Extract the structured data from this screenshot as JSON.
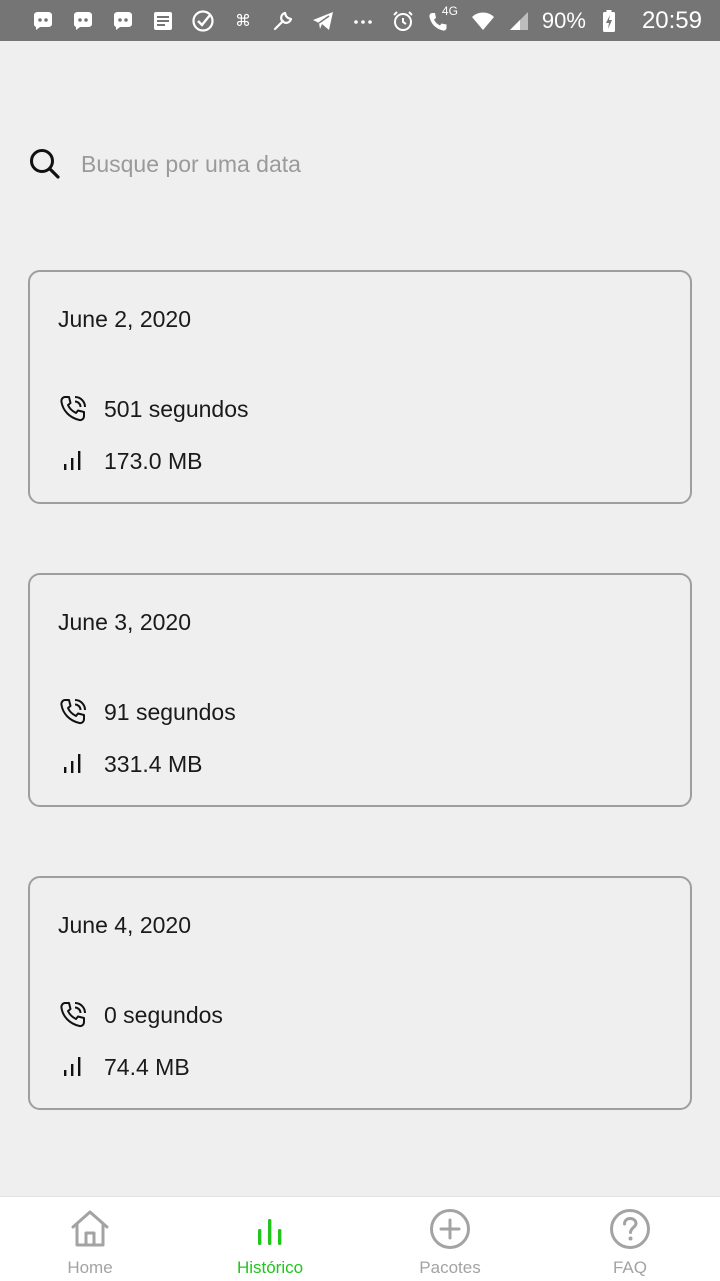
{
  "status_bar": {
    "notification_icons": [
      "discord-icon",
      "discord-icon",
      "discord-icon",
      "news-icon",
      "check-circle-icon",
      "command-icon",
      "wrench-icon",
      "telegram-icon",
      "more-dots-icon"
    ],
    "network_label": "4G",
    "battery": "90%",
    "time": "20:59"
  },
  "search": {
    "placeholder": "Busque por uma data"
  },
  "cards": [
    {
      "date": "June 2, 2020",
      "calls": "501 segundos",
      "data": "173.0 MB"
    },
    {
      "date": "June 3, 2020",
      "calls": "91 segundos",
      "data": "331.4 MB"
    },
    {
      "date": "June 4, 2020",
      "calls": "0 segundos",
      "data": "74.4 MB"
    }
  ],
  "bottom_nav": {
    "items": [
      {
        "label": "Home",
        "icon": "home-icon",
        "active": false
      },
      {
        "label": "Histórico",
        "icon": "bar-chart-icon",
        "active": true
      },
      {
        "label": "Pacotes",
        "icon": "plus-circle-icon",
        "active": false
      },
      {
        "label": "FAQ",
        "icon": "help-circle-icon",
        "active": false
      }
    ]
  },
  "colors": {
    "accent": "#22c51e",
    "background": "#efefef",
    "status_bar": "#757575"
  }
}
